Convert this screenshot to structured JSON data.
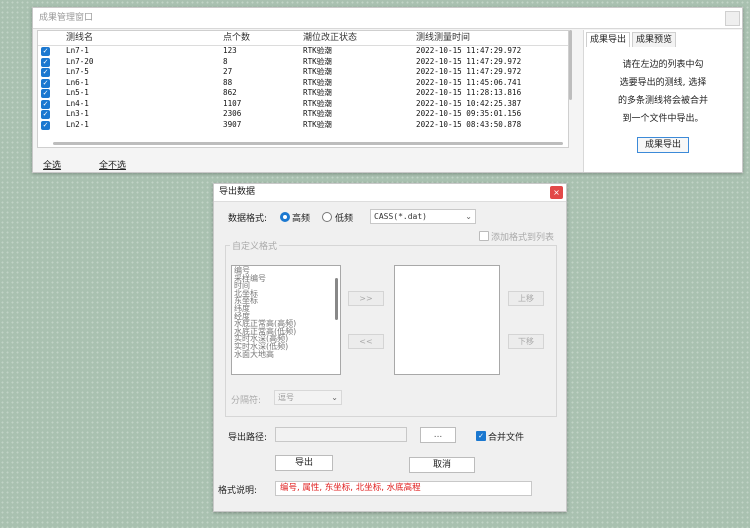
{
  "main_window": {
    "title": "成果管理窗口",
    "columns": [
      "测线名",
      "点个数",
      "潮位改正状态",
      "测线测量时间"
    ],
    "rows": [
      {
        "name": "Ln7-1",
        "count": "123",
        "status": "RTK验潮",
        "time": "2022-10-15 11:47:29.972"
      },
      {
        "name": "Ln7-20",
        "count": "8",
        "status": "RTK验潮",
        "time": "2022-10-15 11:47:29.972"
      },
      {
        "name": "Ln7-5",
        "count": "27",
        "status": "RTK验潮",
        "time": "2022-10-15 11:47:29.972"
      },
      {
        "name": "Ln6-1",
        "count": "88",
        "status": "RTK验潮",
        "time": "2022-10-15 11:45:06.741"
      },
      {
        "name": "Ln5-1",
        "count": "862",
        "status": "RTK验潮",
        "time": "2022-10-15 11:28:13.816"
      },
      {
        "name": "Ln4-1",
        "count": "1107",
        "status": "RTK验潮",
        "time": "2022-10-15 10:42:25.387"
      },
      {
        "name": "Ln3-1",
        "count": "2306",
        "status": "RTK验潮",
        "time": "2022-10-15 09:35:01.156"
      },
      {
        "name": "Ln2-1",
        "count": "3907",
        "status": "RTK验潮",
        "time": "2022-10-15 08:43:50.878"
      }
    ],
    "select_all": "全选",
    "select_none": "全不选",
    "right_panel": {
      "tabs": [
        "成果导出",
        "成果预览"
      ],
      "description_lines": [
        "请在左边的列表中勾",
        "选要导出的测线, 选择",
        "的多条测线将会被合并",
        "到一个文件中导出。"
      ],
      "export_button": "成果导出"
    }
  },
  "dialog": {
    "title": "导出数据",
    "close": "×",
    "format_label": "数据格式:",
    "freq_high": "高频",
    "freq_low": "低频",
    "format_value": "CASS(*.dat)",
    "add_format_label": "添加格式到列表",
    "custom_group_label": "自定义格式",
    "fields": [
      "编号",
      "采样编号",
      "时间",
      "北坐标",
      "东坐标",
      "纬度",
      "经度",
      "水底正常高(高频)",
      "水底正常高(低频)",
      "实时水深(高频)",
      "实时水深(低频)",
      "水面大地高"
    ],
    "add_arrow": ">>",
    "remove_arrow": "<<",
    "move_up": "上移",
    "move_down": "下移",
    "separator_label": "分隔符:",
    "separator_value": "逗号",
    "path_label": "导出路径:",
    "browse_button": "...",
    "merge_label": "合并文件",
    "export_button": "导出",
    "cancel_button": "取消",
    "format_desc_label": "格式说明:",
    "format_desc_value": "编号, 属性, 东坐标, 北坐标, 水底高程"
  },
  "colors": {
    "accent": "#1b78d0",
    "background": "#a9c1b0",
    "format_text": "#e02020"
  }
}
